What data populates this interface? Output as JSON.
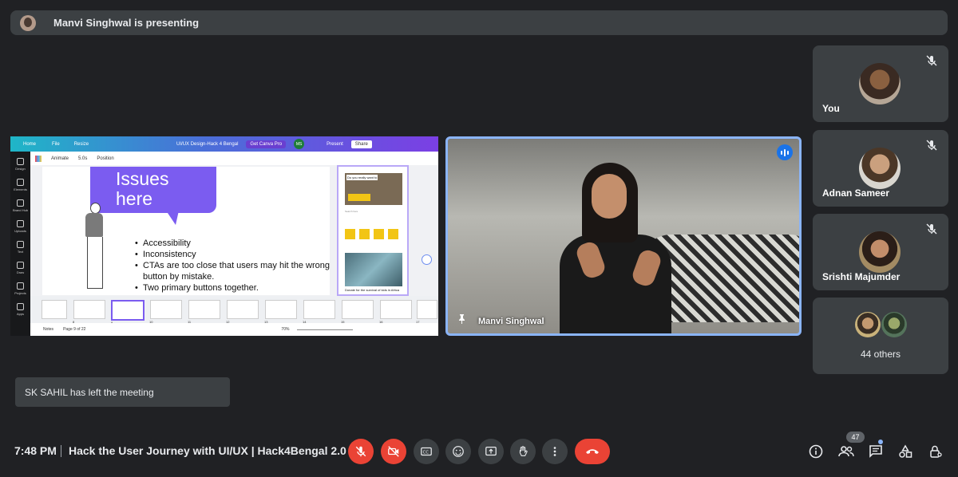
{
  "banner": {
    "presenter_text": "Manvi Singhwal is presenting"
  },
  "canva": {
    "topbar": {
      "home": "Home",
      "file": "File",
      "resize": "Resize",
      "doc_title": "UI/UX Design-Hack 4 Bengal",
      "get_pro": "Get Canva Pro",
      "avatar": "MS",
      "present": "Present",
      "share": "Share"
    },
    "sidebar": [
      "Design",
      "Elements",
      "Brand Hub",
      "Uploads",
      "Text",
      "Draw",
      "Projects",
      "Apps"
    ],
    "toolbar": {
      "animate": "Animate",
      "duration": "5.0s",
      "position": "Position"
    },
    "slide": {
      "heading": "Issues here",
      "bullets": [
        "Accessibility",
        "Inconsistency",
        "CTAs are too close that users may hit the wrong",
        "Two primary buttons together."
      ],
      "bullet_cont": "button by mistake."
    },
    "phone": {
      "banner": "Do you really want to",
      "search": "Search here",
      "caption": "Donate for the survival of kids in Africa"
    },
    "thumbs": [
      "8",
      "9",
      "10",
      "11",
      "12",
      "13",
      "14",
      "15",
      "16",
      "17"
    ],
    "footer": {
      "notes": "Notes",
      "page": "Page 9 of 22",
      "zoom": "70%"
    }
  },
  "speaker": {
    "name": "Manvi Singhwal"
  },
  "participants": [
    {
      "name": "You"
    },
    {
      "name": "Adnan Sameer"
    },
    {
      "name": "Srishti Majumder"
    }
  ],
  "others": {
    "label": "44 others"
  },
  "toast": {
    "text": "SK SAHIL has left the meeting"
  },
  "bottombar": {
    "time": "7:48 PM",
    "meeting_title": "Hack the User Journey with UI/UX | Hack4Bengal 2.0",
    "people_count": "47"
  },
  "colors": {
    "accent": "#8ab4f8",
    "end_call": "#ea4335",
    "tile_bg": "#3c4043",
    "page_bg": "#202124"
  }
}
